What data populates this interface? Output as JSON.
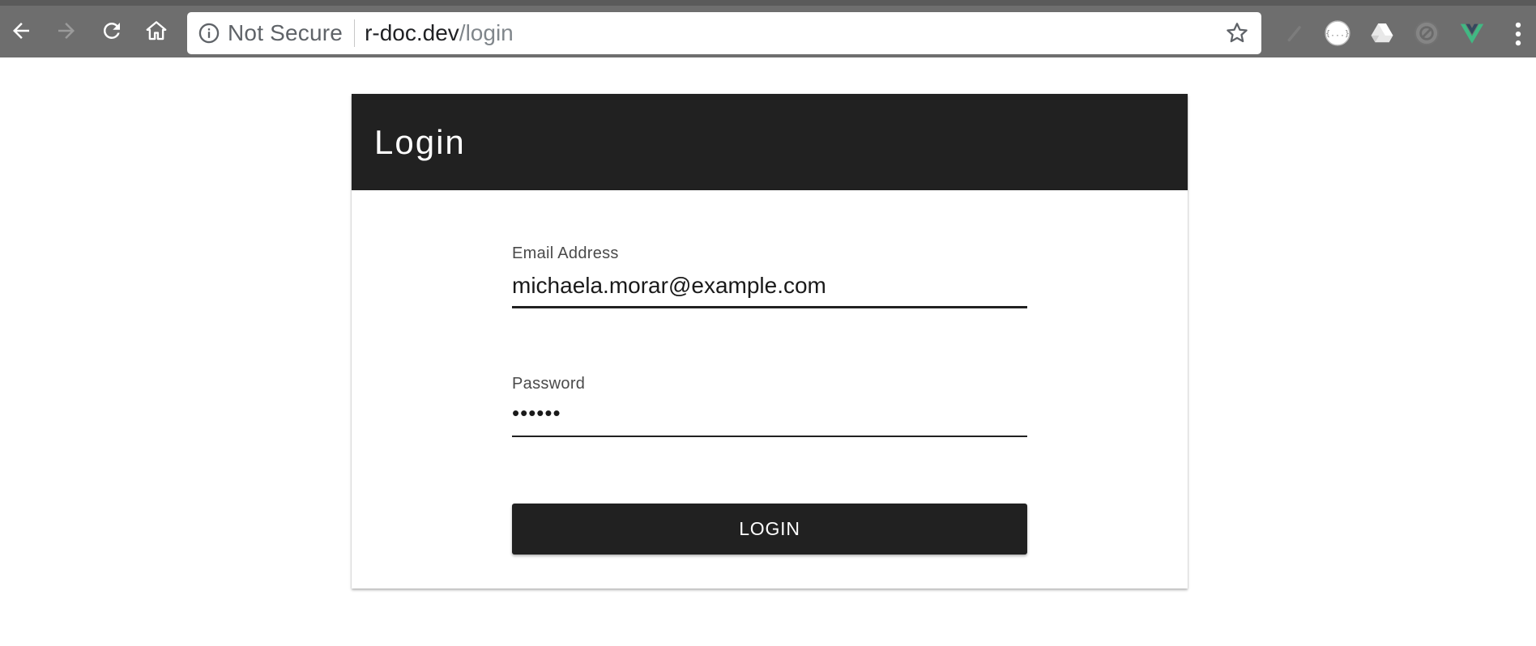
{
  "browser": {
    "security_label": "Not Secure",
    "url_host": "r-doc.dev",
    "url_path": "/login",
    "icons": {
      "back": "back-arrow-icon",
      "forward": "forward-arrow-icon",
      "reload": "reload-icon",
      "home": "home-icon",
      "info": "info-icon",
      "bookmark": "star-icon",
      "extensions": [
        "extension-faded-icon",
        "json-viewer-icon",
        "drive-icon",
        "extension-disabled-icon",
        "vue-devtools-icon"
      ],
      "menu": "menu-dots-icon"
    },
    "colors": {
      "toolbar": "#6e6e6e",
      "vue": "#41b883"
    }
  },
  "login_card": {
    "title": "Login",
    "email": {
      "label": "Email Address",
      "value": "michaela.morar@example.com"
    },
    "password": {
      "label": "Password",
      "value": "••••••"
    },
    "submit_label": "LOGIN",
    "colors": {
      "header": "#212121",
      "button": "#212121"
    }
  }
}
